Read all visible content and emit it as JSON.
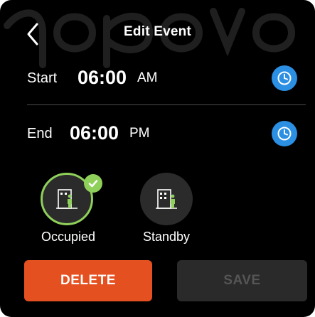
{
  "header": {
    "title": "Edit Event"
  },
  "start": {
    "label": "Start",
    "time": "06:00",
    "ampm": "AM"
  },
  "end": {
    "label": "End",
    "time": "06:00",
    "ampm": "PM"
  },
  "modes": [
    {
      "label": "Occupied",
      "selected": true
    },
    {
      "label": "Standby",
      "selected": false
    }
  ],
  "buttons": {
    "delete": "DELETE",
    "save": "SAVE"
  },
  "colors": {
    "background": "#000000",
    "clock_blue": "#2b8fe3",
    "occupied_green": "#8fd05a",
    "delete_orange": "#e4501f",
    "disabled_gray": "#2a2a2a"
  },
  "icons": {
    "back": "chevron-left-icon",
    "clock": "clock-icon",
    "occupied": "occupied-room-icon",
    "standby": "standby-room-icon",
    "selected": "check-icon"
  }
}
